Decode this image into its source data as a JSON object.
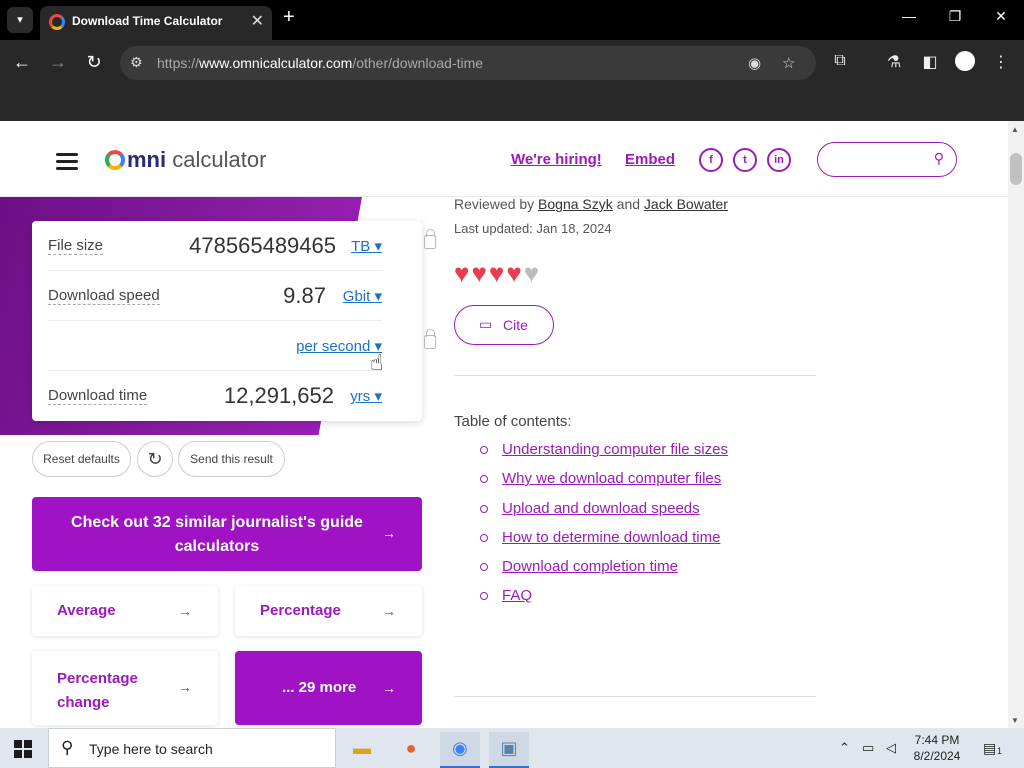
{
  "browser": {
    "tab_title": "Download Time Calculator",
    "url_prefix": "https://",
    "url_host": "www.omnicalculator.com",
    "url_path": "/other/download-time"
  },
  "header": {
    "logo_o": "",
    "logo_mni": "mni",
    "logo_calculator": " calculator",
    "hiring_link": "We're hiring!",
    "embed_link": "Embed",
    "social": [
      "f",
      "t",
      "in"
    ]
  },
  "calculator": {
    "file_size": {
      "label": "File size",
      "value": "478565489465",
      "unit": "TB ▾"
    },
    "download_speed": {
      "label": "Download speed",
      "value": "9.87",
      "unit": "Gbit ▾"
    },
    "speed_per": {
      "unit": "per second ▾"
    },
    "download_time": {
      "label": "Download time",
      "value": "12,291,652",
      "unit": "yrs ▾"
    },
    "reset_label": "Reset defaults",
    "reload_glyph": "↻",
    "share_label": "Send this result"
  },
  "similar": {
    "cta": "Check out 32 similar journalist's guide calculators",
    "tiles": [
      "Average",
      "Percentage",
      "Percentage change",
      "... 29 more"
    ]
  },
  "article": {
    "reviewed_prefix": "Reviewed by ",
    "reviewer1": "Bogna Szyk",
    "and": " and ",
    "reviewer2": "Jack Bowater",
    "updated": "Last updated: Jan 18, 2024",
    "rating_hearts": 4.5,
    "cite_label": "Cite",
    "toc_title": "Table of contents:",
    "toc": [
      "Understanding computer file sizes",
      "Why we download computer files",
      "Upload and download speeds",
      "How to determine download time",
      "Download completion time",
      "FAQ"
    ]
  },
  "taskbar": {
    "search_placeholder": "Type here to search",
    "time": "7:44 PM",
    "date": "8/2/2024",
    "notification_count": "1"
  },
  "colors": {
    "accent": "#9a1bb9",
    "cta_bg": "#a013c4",
    "band": "#7a1696",
    "link_blue": "#1a73c9"
  }
}
